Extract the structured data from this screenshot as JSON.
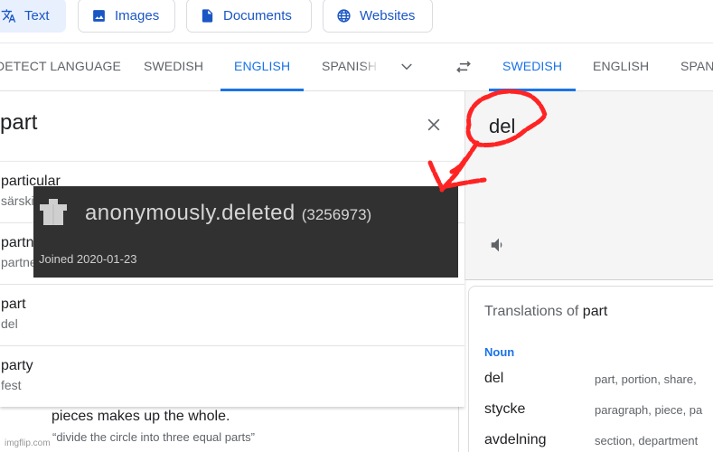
{
  "modes": [
    {
      "label": "Text",
      "icon": "translate-icon",
      "active": true
    },
    {
      "label": "Images",
      "icon": "image-icon",
      "active": false
    },
    {
      "label": "Documents",
      "icon": "document-icon",
      "active": false
    },
    {
      "label": "Websites",
      "icon": "globe-icon",
      "active": false
    }
  ],
  "source_langs": [
    "DETECT LANGUAGE",
    "SWEDISH",
    "ENGLISH",
    "SPANISH"
  ],
  "source_active": "ENGLISH",
  "target_langs": [
    "SWEDISH",
    "ENGLISH",
    "SPANISH"
  ],
  "target_active": "SWEDISH",
  "source": {
    "input_value": "part",
    "suggestions": [
      {
        "word": "particular",
        "translation": "särskild"
      },
      {
        "word": "partner",
        "translation": "partner"
      },
      {
        "word": "part",
        "translation": "del"
      },
      {
        "word": "party",
        "translation": "fest"
      }
    ],
    "definition_line": "pieces makes up the whole.",
    "definition_example": "“divide the circle into three equal parts”"
  },
  "target": {
    "output_value": "del"
  },
  "translations": {
    "title_prefix": "Translations of",
    "title_word": "part",
    "pos": "Noun",
    "rows": [
      {
        "word": "del",
        "synonyms": "part, portion, share,"
      },
      {
        "word": "stycke",
        "synonyms": "paragraph, piece, pa"
      },
      {
        "word": "avdelning",
        "synonyms": "section, department"
      }
    ]
  },
  "overlay": {
    "username": "anonymously.deleted",
    "user_id": "(3256973)",
    "joined": "Joined 2020-01-23"
  },
  "watermark": "imgflip.com",
  "colors": {
    "accent": "#1a73e8",
    "annotation": "#ff2020",
    "overlay_bg": "#313131"
  }
}
